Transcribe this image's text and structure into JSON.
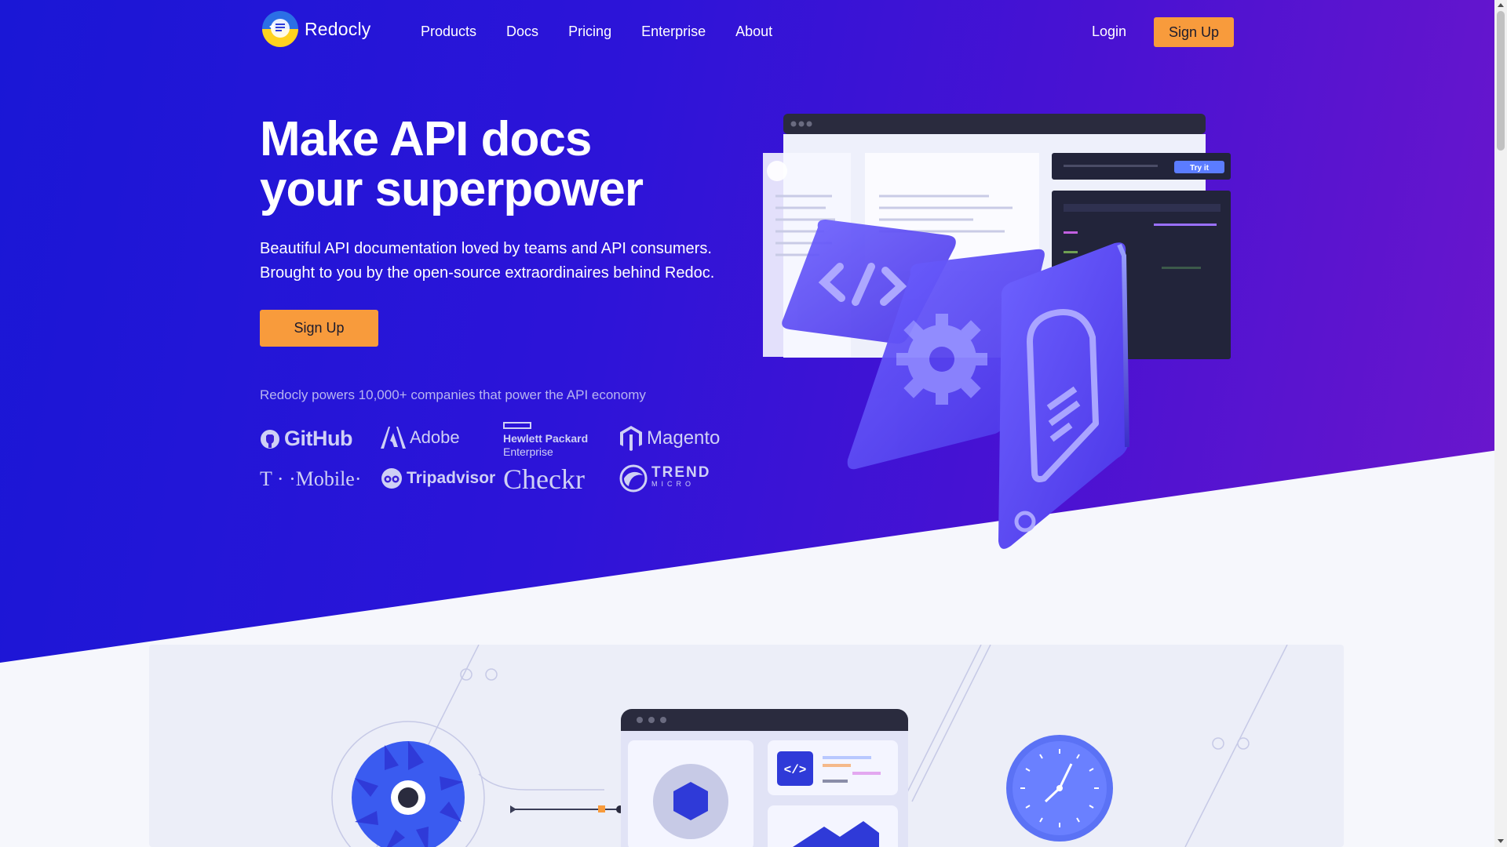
{
  "brand": {
    "name": "Redocly"
  },
  "nav": {
    "links": [
      "Products",
      "Docs",
      "Pricing",
      "Enterprise",
      "About"
    ],
    "login": "Login",
    "signup": "Sign Up"
  },
  "hero": {
    "title_line1": "Make API docs",
    "title_line2": "your superpower",
    "subtitle_line1": "Beautiful API documentation loved by teams and API consumers.",
    "subtitle_line2": "Brought to you by the open-source extraordinaires behind Redoc.",
    "cta": "Sign Up",
    "powers": "Redocly powers 10,000+ companies that power the API economy"
  },
  "companies": {
    "github": "GitHub",
    "adobe": "Adobe",
    "hpe_line1": "Hewlett Packard",
    "hpe_line2": "Enterprise",
    "magento": "Magento",
    "tmobile": "T · ·Mobile·",
    "tripadvisor": "Tripadvisor",
    "checkr": "Checkr",
    "trend_line1": "TREND",
    "trend_line2": "MICRO"
  },
  "illustration": {
    "try_it": "Try it"
  },
  "colors": {
    "accent": "#f89b3c",
    "hero_start": "#1a17d6",
    "hero_end": "#6b16cc",
    "card": "#5a45f0"
  }
}
